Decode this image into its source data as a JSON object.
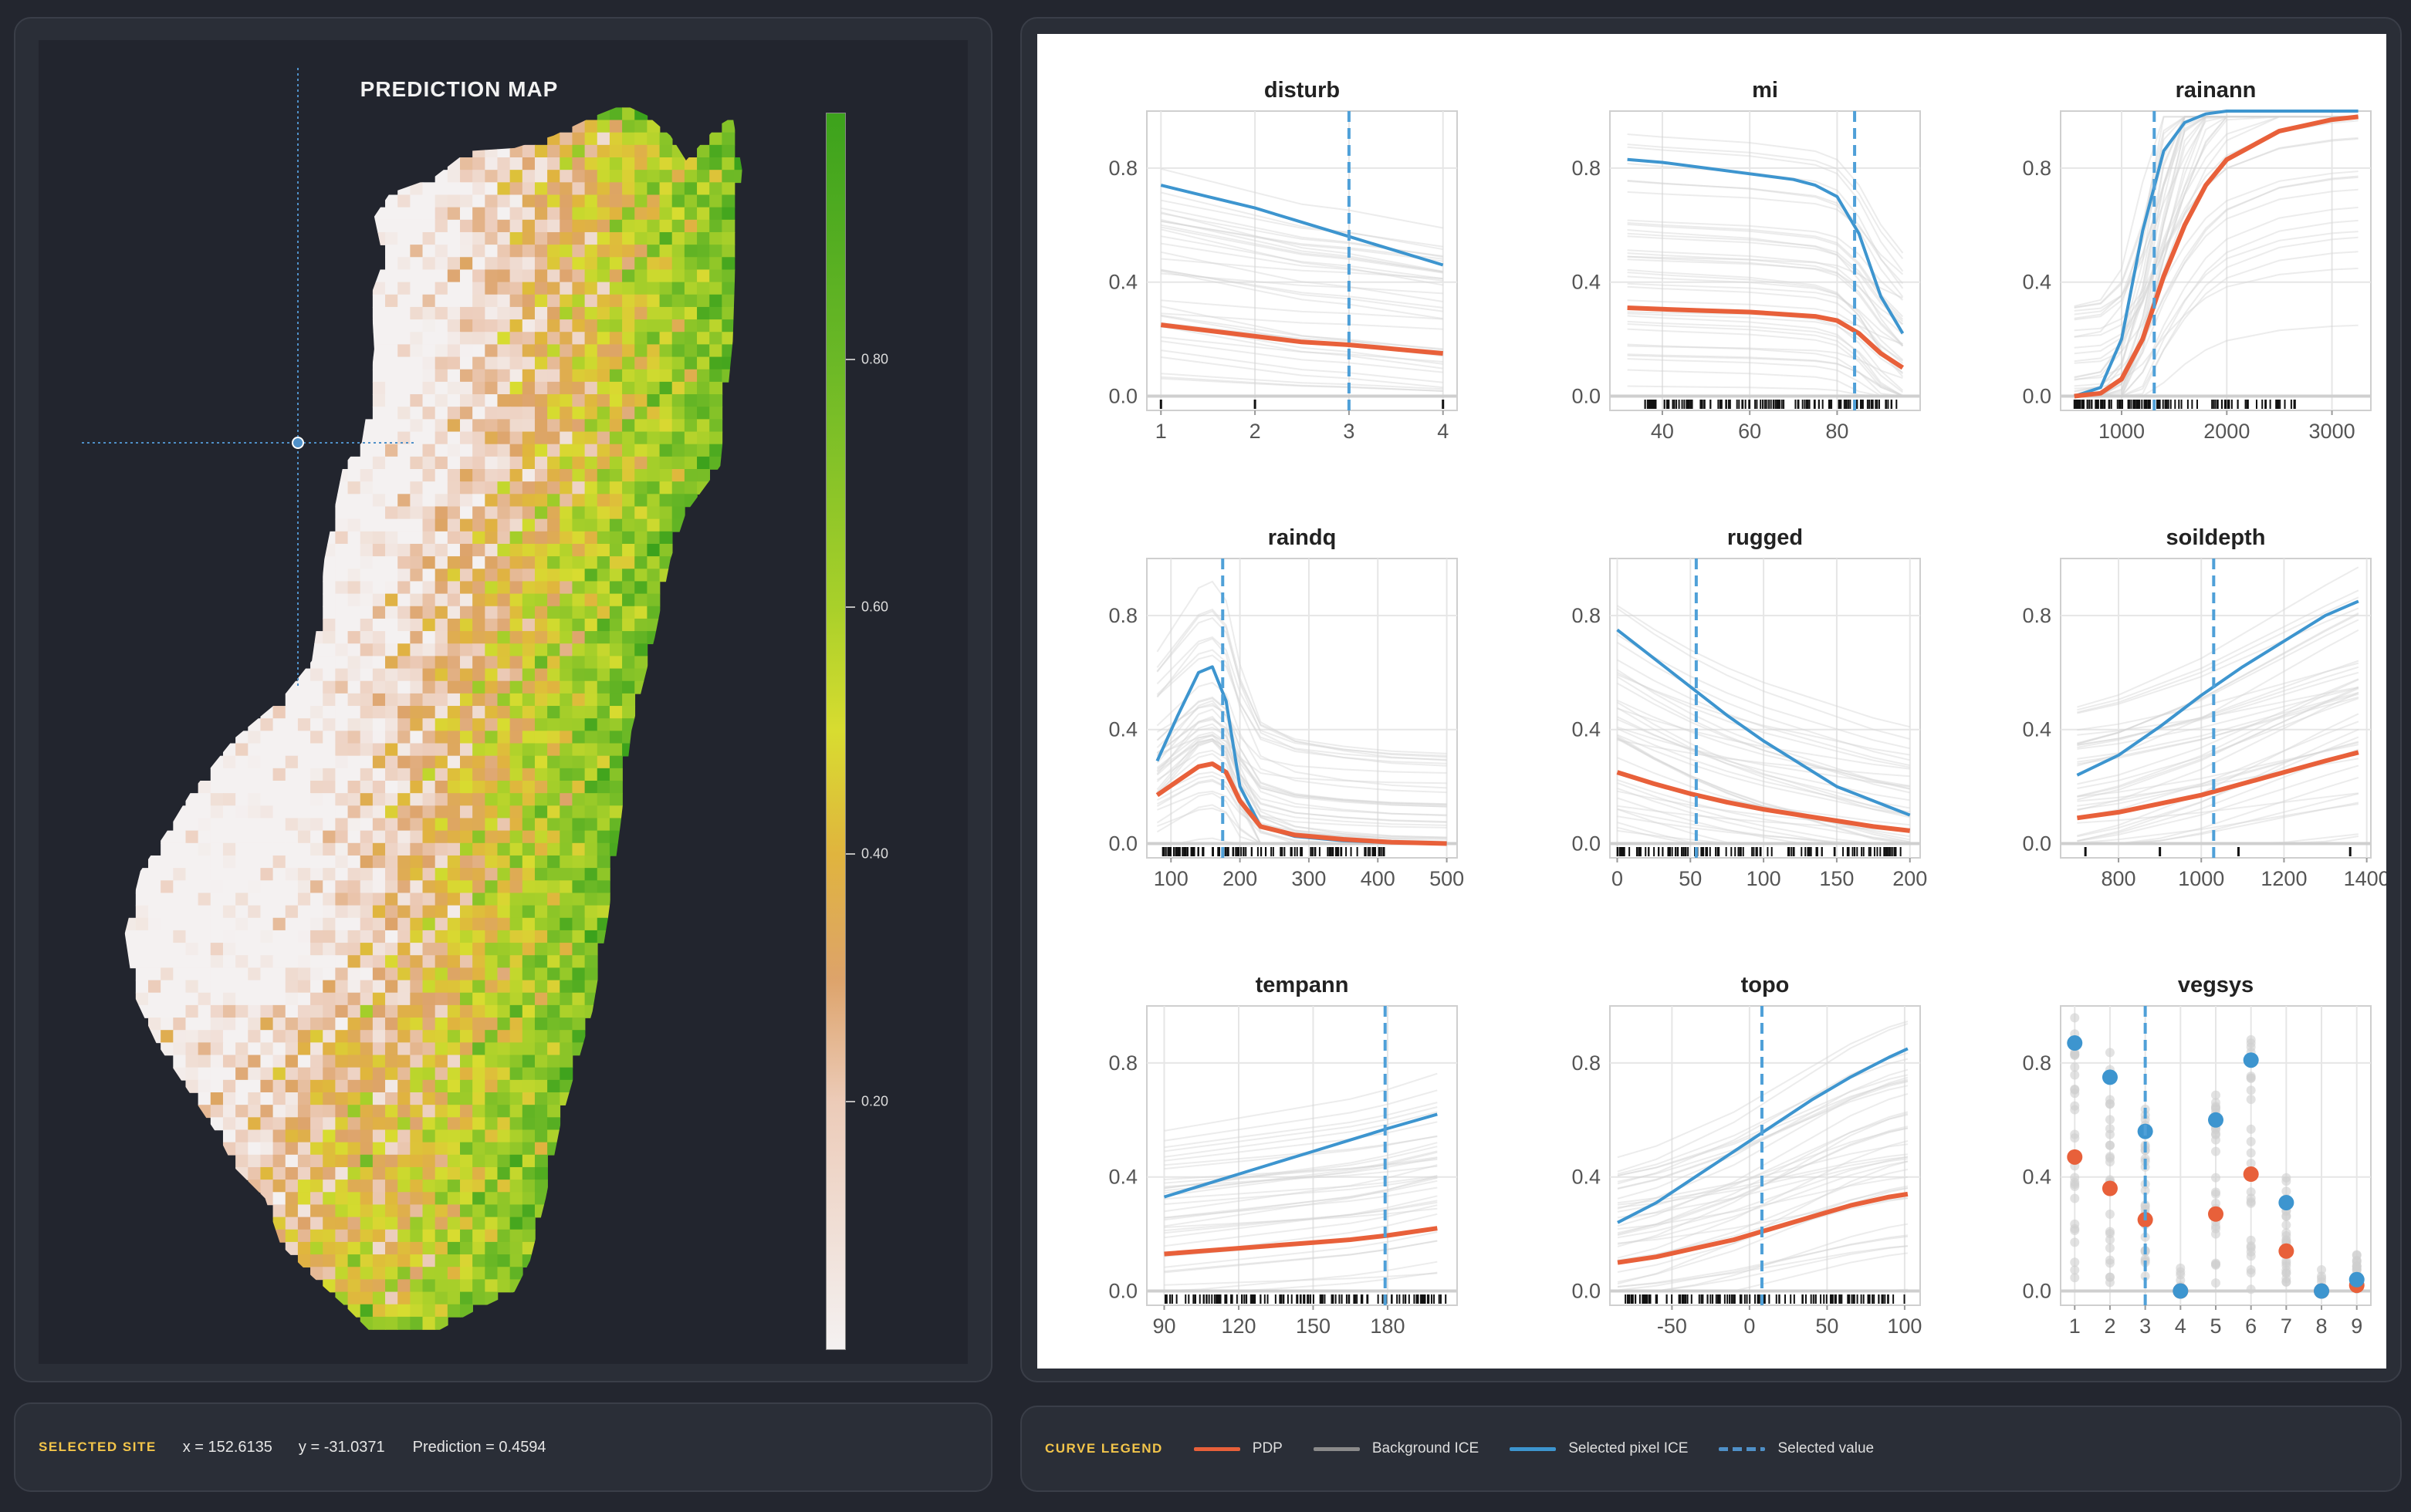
{
  "map": {
    "title": "PREDICTION MAP",
    "colorbar_ticks": [
      {
        "value": 0.8,
        "label": "0.80"
      },
      {
        "value": 0.6,
        "label": "0.60"
      },
      {
        "value": 0.4,
        "label": "0.40"
      },
      {
        "value": 0.2,
        "label": "0.20"
      }
    ]
  },
  "selected_site": {
    "tag": "SELECTED SITE",
    "x_text": "x = 152.6135",
    "y_text": "y = -31.0371",
    "prediction_text": "Prediction = 0.4594"
  },
  "legend": {
    "tag": "CURVE LEGEND",
    "items": [
      {
        "label": "PDP",
        "color": "#e8603a",
        "style": "solid"
      },
      {
        "label": "Background ICE",
        "color": "#8a8a8a",
        "style": "solid"
      },
      {
        "label": "Selected pixel ICE",
        "color": "#3d95cf",
        "style": "solid"
      },
      {
        "label": "Selected value",
        "color": "#4f90c8",
        "style": "dashed"
      }
    ]
  },
  "colors": {
    "pdp": "#e8603a",
    "selected_ice": "#3d95cf",
    "background_ice": "#d4d4d4",
    "selected_value": "#4fa0d8",
    "accent": "#f3c54a"
  },
  "chart_data": [
    {
      "type": "line",
      "title": "disturb",
      "xlim": [
        0.85,
        4.15
      ],
      "ylim": [
        -0.05,
        1.0
      ],
      "xticks": [
        1,
        2,
        3,
        4
      ],
      "xtick_labels": [
        "1",
        "2",
        "3",
        "4"
      ],
      "yticks": [
        0.0,
        0.4,
        0.8
      ],
      "ytick_labels": [
        "0.0",
        "0.4",
        "0.8"
      ],
      "x": [
        1,
        1.5,
        2,
        2.5,
        3,
        3.5,
        4
      ],
      "series": [
        {
          "name": "PDP",
          "values": [
            0.25,
            0.23,
            0.21,
            0.19,
            0.18,
            0.165,
            0.15
          ]
        },
        {
          "name": "Selected pixel ICE",
          "values": [
            0.74,
            0.7,
            0.66,
            0.61,
            0.56,
            0.51,
            0.46
          ]
        }
      ],
      "selected_value": 3,
      "rug": [
        1,
        2,
        3,
        4
      ]
    },
    {
      "type": "line",
      "title": "mi",
      "xlim": [
        28,
        99
      ],
      "ylim": [
        -0.05,
        1.0
      ],
      "xticks": [
        40,
        60,
        80
      ],
      "xtick_labels": [
        "40",
        "60",
        "80"
      ],
      "yticks": [
        0.0,
        0.4,
        0.8
      ],
      "ytick_labels": [
        "0.0",
        "0.4",
        "0.8"
      ],
      "x": [
        32,
        40,
        50,
        60,
        70,
        75,
        80,
        85,
        90,
        95
      ],
      "series": [
        {
          "name": "PDP",
          "values": [
            0.31,
            0.305,
            0.3,
            0.295,
            0.285,
            0.28,
            0.265,
            0.22,
            0.15,
            0.1
          ]
        },
        {
          "name": "Selected pixel ICE",
          "values": [
            0.83,
            0.82,
            0.8,
            0.78,
            0.76,
            0.74,
            0.7,
            0.57,
            0.35,
            0.22
          ]
        }
      ],
      "selected_value": 84,
      "rug_range": [
        36,
        95
      ]
    },
    {
      "type": "line",
      "title": "rainann",
      "xlim": [
        420,
        3370
      ],
      "ylim": [
        -0.05,
        1.0
      ],
      "xticks": [
        1000,
        2000,
        3000
      ],
      "xtick_labels": [
        "1000",
        "2000",
        "3000"
      ],
      "yticks": [
        0.0,
        0.4,
        0.8
      ],
      "ytick_labels": [
        "0.0",
        "0.4",
        "0.8"
      ],
      "x": [
        550,
        800,
        1000,
        1200,
        1400,
        1600,
        1800,
        2000,
        2500,
        3000,
        3250
      ],
      "series": [
        {
          "name": "PDP",
          "values": [
            0.0,
            0.01,
            0.06,
            0.2,
            0.42,
            0.6,
            0.74,
            0.83,
            0.93,
            0.97,
            0.98
          ]
        },
        {
          "name": "Selected pixel ICE",
          "values": [
            0.0,
            0.03,
            0.2,
            0.58,
            0.86,
            0.96,
            0.99,
            1.0,
            1.0,
            1.0,
            1.0
          ]
        }
      ],
      "selected_value": 1310,
      "rug_range": [
        550,
        2650
      ]
    },
    {
      "type": "line",
      "title": "raindq",
      "xlim": [
        65,
        515
      ],
      "ylim": [
        -0.05,
        1.0
      ],
      "xticks": [
        100,
        200,
        300,
        400,
        500
      ],
      "xtick_labels": [
        "100",
        "200",
        "300",
        "400",
        "500"
      ],
      "yticks": [
        0.0,
        0.4,
        0.8
      ],
      "ytick_labels": [
        "0.0",
        "0.4",
        "0.8"
      ],
      "x": [
        80,
        110,
        140,
        160,
        180,
        200,
        230,
        280,
        350,
        420,
        500
      ],
      "series": [
        {
          "name": "PDP",
          "values": [
            0.17,
            0.22,
            0.27,
            0.28,
            0.25,
            0.15,
            0.06,
            0.03,
            0.015,
            0.005,
            0.0
          ]
        },
        {
          "name": "Selected pixel ICE",
          "values": [
            0.29,
            0.45,
            0.6,
            0.62,
            0.5,
            0.2,
            0.06,
            0.025,
            0.01,
            0.003,
            0.0
          ]
        }
      ],
      "selected_value": 175,
      "rug_range": [
        85,
        410
      ]
    },
    {
      "type": "line",
      "title": "rugged",
      "xlim": [
        -5,
        207
      ],
      "ylim": [
        -0.05,
        1.0
      ],
      "xticks": [
        0,
        50,
        100,
        150,
        200
      ],
      "xtick_labels": [
        "0",
        "50",
        "100",
        "150",
        "200"
      ],
      "yticks": [
        0.0,
        0.4,
        0.8
      ],
      "ytick_labels": [
        "0.0",
        "0.4",
        "0.8"
      ],
      "x": [
        0,
        25,
        50,
        75,
        100,
        125,
        150,
        175,
        200
      ],
      "series": [
        {
          "name": "PDP",
          "values": [
            0.25,
            0.21,
            0.175,
            0.145,
            0.12,
            0.1,
            0.08,
            0.06,
            0.045
          ]
        },
        {
          "name": "Selected pixel ICE",
          "values": [
            0.75,
            0.65,
            0.55,
            0.45,
            0.36,
            0.28,
            0.2,
            0.15,
            0.1
          ]
        }
      ],
      "selected_value": 54,
      "rug_range": [
        0,
        195
      ]
    },
    {
      "type": "line",
      "title": "soildepth",
      "xlim": [
        660,
        1410
      ],
      "ylim": [
        -0.05,
        1.0
      ],
      "xticks": [
        800,
        1000,
        1200,
        1400
      ],
      "xtick_labels": [
        "800",
        "1000",
        "1200",
        "1400"
      ],
      "yticks": [
        0.0,
        0.4,
        0.8
      ],
      "ytick_labels": [
        "0.0",
        "0.4",
        "0.8"
      ],
      "x": [
        700,
        800,
        900,
        1000,
        1100,
        1200,
        1300,
        1380
      ],
      "series": [
        {
          "name": "PDP",
          "values": [
            0.09,
            0.11,
            0.14,
            0.17,
            0.21,
            0.25,
            0.29,
            0.32
          ]
        },
        {
          "name": "Selected pixel ICE",
          "values": [
            0.24,
            0.31,
            0.41,
            0.52,
            0.62,
            0.71,
            0.8,
            0.85
          ]
        }
      ],
      "selected_value": 1030,
      "rug": [
        720,
        900,
        1090,
        1360
      ]
    },
    {
      "type": "line",
      "title": "tempann",
      "xlim": [
        83,
        208
      ],
      "ylim": [
        -0.05,
        1.0
      ],
      "xticks": [
        90,
        120,
        150,
        180
      ],
      "xtick_labels": [
        "90",
        "120",
        "150",
        "180"
      ],
      "yticks": [
        0.0,
        0.4,
        0.8
      ],
      "ytick_labels": [
        "0.0",
        "0.4",
        "0.8"
      ],
      "x": [
        90,
        105,
        120,
        135,
        150,
        165,
        180,
        200
      ],
      "series": [
        {
          "name": "PDP",
          "values": [
            0.13,
            0.14,
            0.15,
            0.16,
            0.17,
            0.18,
            0.195,
            0.22
          ]
        },
        {
          "name": "Selected pixel ICE",
          "values": [
            0.33,
            0.37,
            0.41,
            0.45,
            0.49,
            0.53,
            0.57,
            0.62
          ]
        }
      ],
      "selected_value": 179,
      "rug_range": [
        90,
        205
      ]
    },
    {
      "type": "line",
      "title": "topo",
      "xlim": [
        -90,
        110
      ],
      "ylim": [
        -0.05,
        1.0
      ],
      "xticks": [
        -50,
        0,
        50,
        100
      ],
      "xtick_labels": [
        "-50",
        "0",
        "50",
        "100"
      ],
      "yticks": [
        0.0,
        0.4,
        0.8
      ],
      "ytick_labels": [
        "0.0",
        "0.4",
        "0.8"
      ],
      "x": [
        -85,
        -60,
        -35,
        -10,
        15,
        40,
        65,
        90,
        102
      ],
      "series": [
        {
          "name": "PDP",
          "values": [
            0.1,
            0.12,
            0.15,
            0.18,
            0.22,
            0.26,
            0.3,
            0.33,
            0.34
          ]
        },
        {
          "name": "Selected pixel ICE",
          "values": [
            0.24,
            0.31,
            0.4,
            0.49,
            0.58,
            0.67,
            0.75,
            0.82,
            0.85
          ]
        }
      ],
      "selected_value": 8,
      "rug_range": [
        -80,
        100
      ]
    },
    {
      "type": "scatter",
      "title": "vegsys",
      "xlim": [
        0.6,
        9.4
      ],
      "ylim": [
        -0.05,
        1.0
      ],
      "xticks": [
        1,
        2,
        3,
        4,
        5,
        6,
        7,
        8,
        9
      ],
      "xtick_labels": [
        "1",
        "2",
        "3",
        "4",
        "5",
        "6",
        "7",
        "8",
        "9"
      ],
      "yticks": [
        0.0,
        0.4,
        0.8
      ],
      "ytick_labels": [
        "0.0",
        "0.4",
        "0.8"
      ],
      "x": [
        1,
        2,
        3,
        4,
        5,
        6,
        7,
        8,
        9
      ],
      "series": [
        {
          "name": "PDP",
          "values": [
            0.47,
            0.36,
            0.25,
            0.0,
            0.27,
            0.41,
            0.14,
            0.0,
            0.02
          ]
        },
        {
          "name": "Selected pixel ICE",
          "values": [
            0.87,
            0.75,
            0.56,
            0.0,
            0.6,
            0.81,
            0.31,
            0.0,
            0.04
          ]
        }
      ],
      "selected_value": 3
    }
  ]
}
